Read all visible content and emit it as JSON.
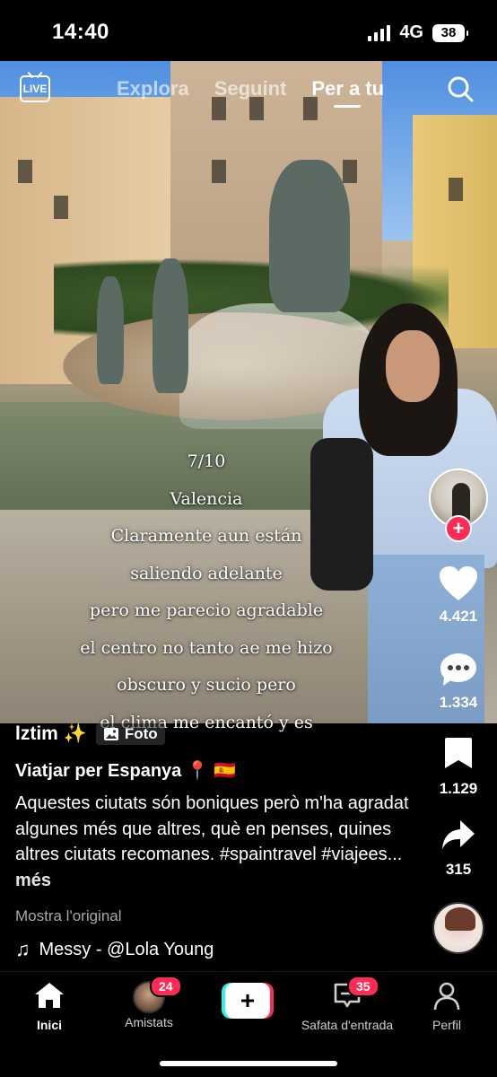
{
  "status_bar": {
    "time": "14:40",
    "network": "4G",
    "battery": "38"
  },
  "top_nav": {
    "live_label": "LIVE",
    "tabs": [
      {
        "label": "Explora",
        "active": false
      },
      {
        "label": "Seguint",
        "active": false
      },
      {
        "label": "Per a tu",
        "active": true
      }
    ]
  },
  "post": {
    "overlay_lines": [
      "7/10",
      "Valencia",
      "Claramente aun están",
      "saliendo adelante",
      "pero me parecio agradable",
      "el centro no tanto ae me hizo",
      "obscuro y sucio pero",
      "el clima me encantó y es"
    ],
    "author": "lztim ✨",
    "type_tag": "Foto",
    "title": "Viatjar per Espanya 📍 🇪🇸",
    "description": "Aquestes ciutats són boniques però m'ha agradat algunes més que altres, què en penses, quines altres ciutats recomanes. #spaintravel #viajees...",
    "more_label": "més",
    "show_original": "Mostra l'original",
    "sound": "Messy - @Lola Young"
  },
  "actions": {
    "likes": "4.421",
    "comments": "1.334",
    "saves": "1.129",
    "shares": "315"
  },
  "bottom_nav": {
    "items": [
      {
        "label": "Inici",
        "active": true
      },
      {
        "label": "Amistats",
        "badge": "24"
      },
      {
        "label": "Safata d'entrada",
        "badge": "35"
      },
      {
        "label": "Perfil"
      }
    ]
  },
  "colors": {
    "accent": "#fe2c55",
    "cyan": "#25f4ee",
    "background": "#000000"
  }
}
